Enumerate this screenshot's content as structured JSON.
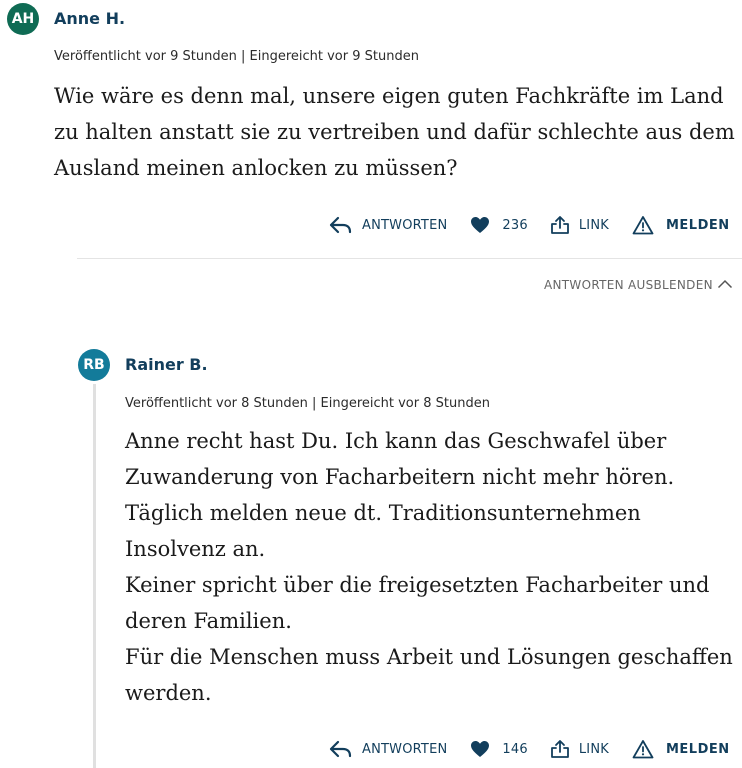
{
  "colors": {
    "avatar_anne": "#0f6b54",
    "avatar_rainer": "#137b9a",
    "link": "#123e5c"
  },
  "comments": [
    {
      "initials": "AH",
      "author": "Anne H.",
      "meta": "Veröffentlicht vor 9 Stunden | Eingereicht vor 9 Stunden",
      "paragraphs": [
        "Wie wäre es denn mal, unsere eigen guten Fachkräfte im Land zu halten anstatt sie zu vertreiben und dafür schlechte aus dem Ausland meinen anlocken zu müssen?"
      ],
      "actions": {
        "reply": "ANTWORTEN",
        "likes": "236",
        "link": "LINK",
        "report": "MELDEN"
      }
    },
    {
      "initials": "RB",
      "author": "Rainer B.",
      "meta": "Veröffentlicht vor 8 Stunden | Eingereicht vor 8 Stunden",
      "paragraphs": [
        "Anne recht hast Du. Ich kann das Geschwafel über Zuwanderung von Facharbeitern nicht mehr hören.",
        "Täglich melden neue dt. Traditionsunternehmen Insolvenz an.",
        "Keiner spricht über die freigesetzten Facharbeiter und deren Familien.",
        "Für die Menschen muss Arbeit und Lösungen geschaffen werden."
      ],
      "actions": {
        "reply": "ANTWORTEN",
        "likes": "146",
        "link": "LINK",
        "report": "MELDEN"
      }
    }
  ],
  "replies_toggle": "ANTWORTEN AUSBLENDEN"
}
